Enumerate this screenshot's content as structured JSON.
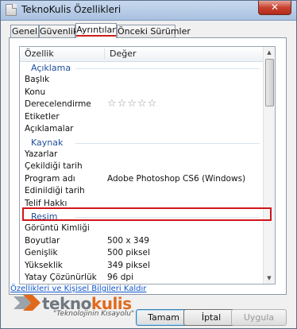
{
  "window": {
    "title": "TeknoKulis Özellikleri",
    "close_label": "✕"
  },
  "tabs": [
    {
      "label": "Genel"
    },
    {
      "label": "Güvenlik"
    },
    {
      "label": "Ayrıntılar"
    },
    {
      "label": "Önceki Sürümler"
    }
  ],
  "active_tab": "Ayrıntılar",
  "list": {
    "header": {
      "property": "Özellik",
      "value": "Değer"
    },
    "groups": [
      {
        "label": "Açıklama",
        "rows": [
          {
            "key": "Başlık",
            "value": ""
          },
          {
            "key": "Konu",
            "value": ""
          },
          {
            "key": "Derecelendirme",
            "value": "☆☆☆☆☆"
          },
          {
            "key": "Etiketler",
            "value": ""
          },
          {
            "key": "Açıklamalar",
            "value": ""
          }
        ]
      },
      {
        "label": "Kaynak",
        "rows": [
          {
            "key": "Yazarlar",
            "value": ""
          },
          {
            "key": "Çekildiği tarih",
            "value": ""
          },
          {
            "key": "Program adı",
            "value": "Adobe Photoshop CS6 (Windows)"
          },
          {
            "key": "Edinildiği tarih",
            "value": ""
          },
          {
            "key": "Telif Hakkı",
            "value": ""
          }
        ]
      },
      {
        "label": "Resim",
        "rows": [
          {
            "key": "Görüntü Kimliği",
            "value": ""
          },
          {
            "key": "Boyutlar",
            "value": "500 x 349"
          },
          {
            "key": "Genişlik",
            "value": "500 piksel"
          },
          {
            "key": "Yükseklik",
            "value": "349 piksel"
          },
          {
            "key": "Yatay Çözünürlük",
            "value": "96 dpi"
          }
        ]
      }
    ],
    "highlighted_row": "Program adı"
  },
  "link": "Özellikleri ve Kişisel Bilgileri Kaldır",
  "logo": {
    "brand_gray": "tekno",
    "brand_orange": "kulis",
    "tagline": "\"Teknolojinin Kısayolu\""
  },
  "buttons": {
    "ok": "Tamam",
    "cancel": "İptal",
    "apply": "Uygula"
  },
  "colors": {
    "highlight": "#d0161b",
    "group": "#1e4e9c",
    "link": "#1155cc",
    "logo_orange": "#e06a1c"
  }
}
